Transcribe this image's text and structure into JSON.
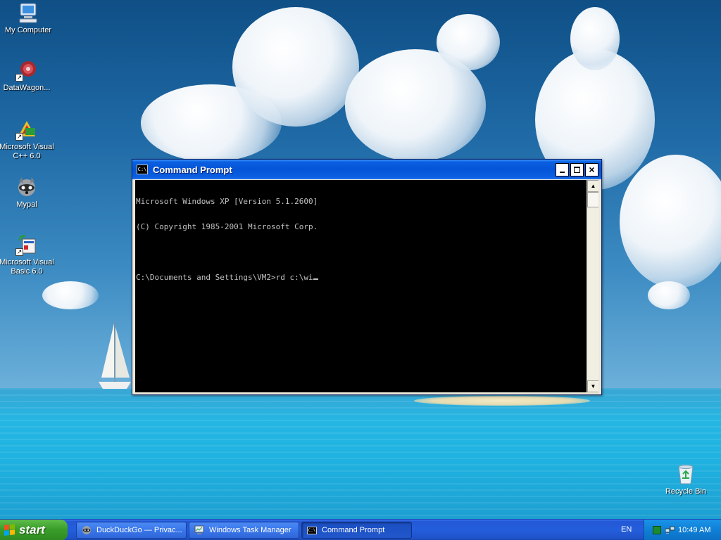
{
  "desktop": {
    "icons": [
      {
        "label": "My Computer",
        "icon": "computer-icon"
      },
      {
        "label": "DataWagon...",
        "icon": "datawagon-icon"
      },
      {
        "label": "Microsoft Visual C++ 6.0",
        "icon": "visual-cpp-icon"
      },
      {
        "label": "Mypal",
        "icon": "mypal-raccoon-icon"
      },
      {
        "label": "Microsoft Visual Basic 6.0",
        "icon": "visual-basic-icon"
      },
      {
        "label": "Recycle Bin",
        "icon": "recycle-bin-icon"
      }
    ]
  },
  "cmd_window": {
    "title": "Command Prompt",
    "title_icon_text": "C:\\",
    "lines": [
      "Microsoft Windows XP [Version 5.1.2600]",
      "(C) Copyright 1985-2001 Microsoft Corp.",
      "",
      "C:\\Documents and Settings\\VM2>rd c:\\wi"
    ],
    "buttons": {
      "minimize": "minimize-icon",
      "maximize": "maximize-icon",
      "close": "×"
    }
  },
  "taskbar": {
    "start_label": "start",
    "tasks": [
      {
        "label": "DuckDuckGo — Privac...",
        "icon": "mypal-raccoon-icon",
        "active": false
      },
      {
        "label": "Windows Task Manager",
        "icon": "task-manager-icon",
        "active": false
      },
      {
        "label": "Command Prompt",
        "icon": "cmd-icon",
        "active": true
      }
    ],
    "language": "EN",
    "clock": "10:49 AM"
  }
}
